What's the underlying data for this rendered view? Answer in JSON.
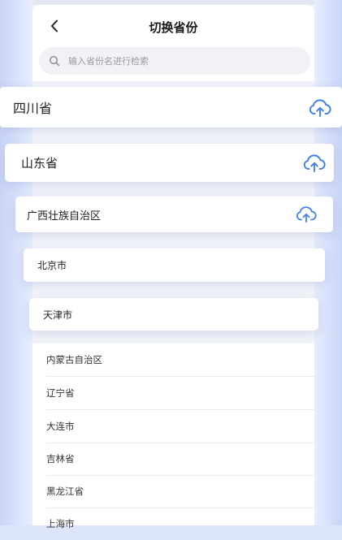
{
  "header": {
    "title": "切换省份",
    "search_placeholder": "输入省份名进行检索"
  },
  "cards": [
    {
      "label": "四川省",
      "icon": "upload-cloud-icon"
    },
    {
      "label": "山东省",
      "icon": "upload-cloud-icon"
    },
    {
      "label": "广西壮族自治区",
      "icon": "upload-cloud-icon"
    },
    {
      "label": "北京市"
    },
    {
      "label": "天津市"
    }
  ],
  "list": [
    "内蒙古自治区",
    "辽宁省",
    "大连市",
    "吉林省",
    "黑龙江省",
    "上海市"
  ],
  "colors": {
    "accent": "#3f7ff0",
    "background": "#dde5fb"
  }
}
